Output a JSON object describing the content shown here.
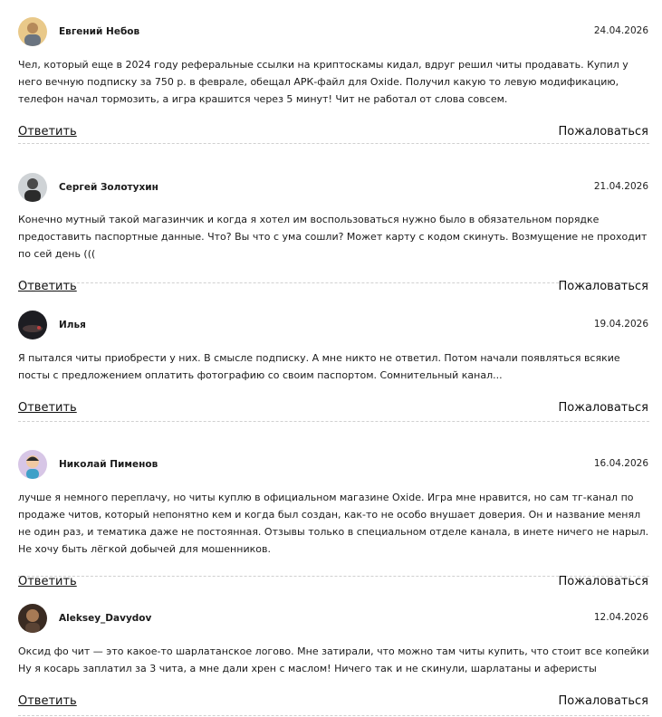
{
  "comments": [
    {
      "author": "Евгений Небов",
      "date": "24.04.2026",
      "text": "Чел, который еще в 2024 году реферальные ссылки на криптоскамы кидал, вдруг решил читы продавать. Купил у него вечную подписку за 750 р. в феврале, обещал АРК-файл для Oxide. Получил какую то левую модификацию, телефон начал тормозить, а игра крашится через 5 минут! Чит не работал от слова совсем.",
      "reply_label": "Ответить",
      "report_label": "Пожаловаться"
    },
    {
      "author": "Сергей Золотухин",
      "date": "21.04.2026",
      "text": "Конечно мутный такой магазинчик и когда я хотел им воспользоваться нужно было в обязательном порядке предоставить паспортные данные. Что? Вы что с ума сошли? Может карту с кодом скинуть. Возмущение не проходит по сей день (((",
      "reply_label": "Ответить",
      "report_label": "Пожаловаться"
    },
    {
      "author": "Илья",
      "date": "19.04.2026",
      "text": "Я пытался читы приобрести у них. В смысле подписку. А мне никто не ответил. Потом начали появляться всякие посты с предложением оплатить фотографию со своим паспортом. Сомнительный канал...",
      "reply_label": "Ответить",
      "report_label": "Пожаловаться"
    },
    {
      "author": "Николай Пименов",
      "date": "16.04.2026",
      "text": "лучше я немного переплачу, но читы куплю в официальном магазине Oxide. Игра мне нравится, но сам тг-канал по продаже читов, который непонятно кем и когда был создан, как-то не особо внушает доверия. Он и название менял не один раз, и тематика даже не постоянная. Отзывы только в специальном отделе канала, в инете ничего не нарыл. Не хочу быть лёгкой добычей для мошенников.",
      "reply_label": "Ответить",
      "report_label": "Пожаловаться"
    },
    {
      "author": "Aleksey_Davydov",
      "date": "12.04.2026",
      "text": "Оксид фо чит — это какое-то шарлатанское логово. Мне затирали, что можно там читы купить, что стоит все копейки Ну я косарь заплатил за 3 чита, а мне дали хрен с маслом! Ничего так и не скинули, шарлатаны и аферисты",
      "reply_label": "Ответить",
      "report_label": "Пожаловаться"
    }
  ]
}
